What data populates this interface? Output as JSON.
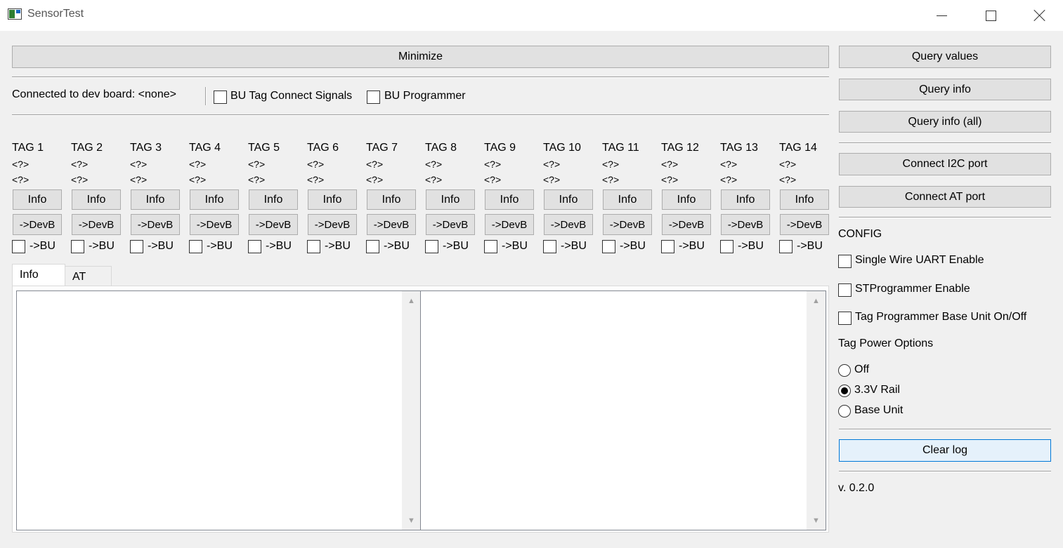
{
  "window": {
    "title": "SensorTest"
  },
  "toolbar": {
    "minimize_label": "Minimize",
    "connected_label": "Connected to dev board: <none>",
    "bu_tag_connect_label": "BU Tag Connect Signals",
    "bu_programmer_label": "BU Programmer"
  },
  "tags": [
    {
      "name": "TAG 1",
      "v1": "<?>",
      "v2": "<?>",
      "info": "Info",
      "devb": "->DevB",
      "bu": "->BU"
    },
    {
      "name": "TAG 2",
      "v1": "<?>",
      "v2": "<?>",
      "info": "Info",
      "devb": "->DevB",
      "bu": "->BU"
    },
    {
      "name": "TAG 3",
      "v1": "<?>",
      "v2": "<?>",
      "info": "Info",
      "devb": "->DevB",
      "bu": "->BU"
    },
    {
      "name": "TAG 4",
      "v1": "<?>",
      "v2": "<?>",
      "info": "Info",
      "devb": "->DevB",
      "bu": "->BU"
    },
    {
      "name": "TAG 5",
      "v1": "<?>",
      "v2": "<?>",
      "info": "Info",
      "devb": "->DevB",
      "bu": "->BU"
    },
    {
      "name": "TAG 6",
      "v1": "<?>",
      "v2": "<?>",
      "info": "Info",
      "devb": "->DevB",
      "bu": "->BU"
    },
    {
      "name": "TAG 7",
      "v1": "<?>",
      "v2": "<?>",
      "info": "Info",
      "devb": "->DevB",
      "bu": "->BU"
    },
    {
      "name": "TAG 8",
      "v1": "<?>",
      "v2": "<?>",
      "info": "Info",
      "devb": "->DevB",
      "bu": "->BU"
    },
    {
      "name": "TAG 9",
      "v1": "<?>",
      "v2": "<?>",
      "info": "Info",
      "devb": "->DevB",
      "bu": "->BU"
    },
    {
      "name": "TAG 10",
      "v1": "<?>",
      "v2": "<?>",
      "info": "Info",
      "devb": "->DevB",
      "bu": "->BU"
    },
    {
      "name": "TAG 11",
      "v1": "<?>",
      "v2": "<?>",
      "info": "Info",
      "devb": "->DevB",
      "bu": "->BU"
    },
    {
      "name": "TAG 12",
      "v1": "<?>",
      "v2": "<?>",
      "info": "Info",
      "devb": "->DevB",
      "bu": "->BU"
    },
    {
      "name": "TAG 13",
      "v1": "<?>",
      "v2": "<?>",
      "info": "Info",
      "devb": "->DevB",
      "bu": "->BU"
    },
    {
      "name": "TAG 14",
      "v1": "<?>",
      "v2": "<?>",
      "info": "Info",
      "devb": "->DevB",
      "bu": "->BU"
    }
  ],
  "tabs": [
    {
      "label": "Info",
      "active": true
    },
    {
      "label": "AT",
      "active": false
    }
  ],
  "side": {
    "query_values": "Query values",
    "query_info": "Query info",
    "query_info_all": "Query info (all)",
    "connect_i2c": "Connect I2C port",
    "connect_at": "Connect AT port",
    "config_heading": "CONFIG",
    "single_wire_uart": "Single Wire UART Enable",
    "st_programmer": "STProgrammer Enable",
    "tag_programmer_bu": "Tag Programmer Base Unit On/Off",
    "power_heading": "Tag Power Options",
    "power_options": [
      {
        "label": "Off",
        "checked": false
      },
      {
        "label": "3.3V Rail",
        "checked": true
      },
      {
        "label": "Base Unit",
        "checked": false
      }
    ],
    "clear_log": "Clear log",
    "version": "v. 0.2.0"
  }
}
